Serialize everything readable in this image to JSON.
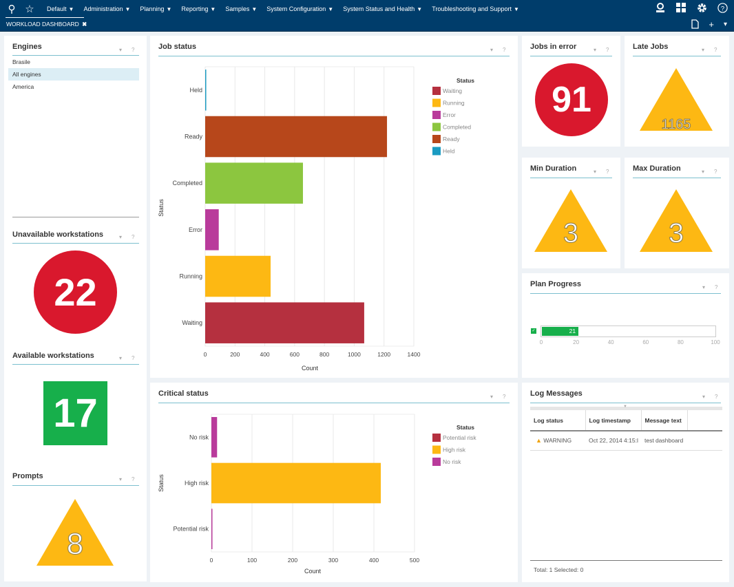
{
  "nav": {
    "menus": [
      "Default",
      "Administration",
      "Planning",
      "Reporting",
      "Samples",
      "System Configuration",
      "System Status and Health",
      "Troubleshooting and Support"
    ],
    "tab_label": "WORKLOAD DASHBOARD",
    "tab_close": "✖",
    "icons": {
      "search": "⚲",
      "favorite": "☆",
      "user": "👤",
      "apps": "▦",
      "settings": "⚙",
      "help": "?",
      "page": "🗋",
      "add": "+",
      "more": "▾"
    }
  },
  "engines": {
    "title": "Engines",
    "items": [
      {
        "label": "Brasile",
        "selected": false
      },
      {
        "label": "All engines",
        "selected": true
      },
      {
        "label": "America",
        "selected": false
      }
    ]
  },
  "unavailable_workstations": {
    "title": "Unavailable workstations",
    "value": "22",
    "color": "#d9182d"
  },
  "available_workstations": {
    "title": "Available workstations",
    "value": "17",
    "color": "#17af4b"
  },
  "prompts": {
    "title": "Prompts",
    "value": "8",
    "color": "#fdb813"
  },
  "jobs_in_error": {
    "title": "Jobs in error",
    "value": "91",
    "color": "#d9182d"
  },
  "late_jobs": {
    "title": "Late Jobs",
    "value": "1165",
    "color": "#fdb813"
  },
  "min_duration": {
    "title": "Min Duration",
    "value": "3",
    "color": "#fdb813"
  },
  "max_duration": {
    "title": "Max Duration",
    "value": "3",
    "color": "#fdb813"
  },
  "plan_progress": {
    "title": "Plan Progress",
    "value": 21,
    "value_label": "21",
    "ticks": [
      "0",
      "20",
      "40",
      "60",
      "80",
      "100"
    ],
    "color": "#17af4b"
  },
  "log_messages": {
    "title": "Log Messages",
    "columns": [
      "Log status",
      "Log timestamp",
      "Message text"
    ],
    "rows": [
      {
        "status": "WARNING",
        "timestamp": "Oct 22, 2014 4:15:l",
        "message": "test dashboard"
      }
    ],
    "footer": "Total: 1 Selected: 0"
  },
  "panel_controls": {
    "menu": "▾",
    "help": "?"
  },
  "chart_data": [
    {
      "type": "bar",
      "orientation": "horizontal",
      "title": "Job status",
      "xlabel": "Count",
      "ylabel": "Status",
      "categories": [
        "Held",
        "Ready",
        "Completed",
        "Error",
        "Running",
        "Waiting"
      ],
      "values": [
        2,
        1220,
        656,
        91,
        439,
        1067
      ],
      "colors": [
        "#1b9bc2",
        "#b7471b",
        "#8cc63f",
        "#b93b9b",
        "#fdb813",
        "#b5303f"
      ],
      "xlim": [
        0,
        1400
      ],
      "xticks": [
        "0",
        "200",
        "400",
        "600",
        "800",
        "1000",
        "1200",
        "1400"
      ],
      "grid": true,
      "legend": {
        "title": "Status",
        "position": "right",
        "entries": [
          {
            "label": "Waiting",
            "color": "#b5303f"
          },
          {
            "label": "Running",
            "color": "#fdb813"
          },
          {
            "label": "Error",
            "color": "#b93b9b"
          },
          {
            "label": "Completed",
            "color": "#8cc63f"
          },
          {
            "label": "Ready",
            "color": "#b7471b"
          },
          {
            "label": "Held",
            "color": "#1b9bc2"
          }
        ]
      }
    },
    {
      "type": "bar",
      "orientation": "horizontal",
      "title": "Critical status",
      "xlabel": "Count",
      "ylabel": "Status",
      "categories": [
        "No risk",
        "High risk",
        "Potential risk"
      ],
      "values": [
        14,
        417,
        1
      ],
      "colors": [
        "#b93b9b",
        "#fdb813",
        "#b93b9b"
      ],
      "xlim": [
        0,
        500
      ],
      "xticks": [
        "0",
        "100",
        "200",
        "300",
        "400",
        "500"
      ],
      "grid": true,
      "legend": {
        "title": "Status",
        "position": "right",
        "entries": [
          {
            "label": "Potential risk",
            "color": "#b5303f"
          },
          {
            "label": "High risk",
            "color": "#fdb813"
          },
          {
            "label": "No risk",
            "color": "#b93b9b"
          }
        ]
      }
    }
  ]
}
